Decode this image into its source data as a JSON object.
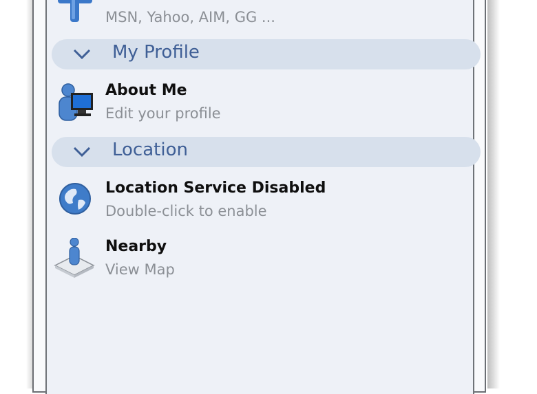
{
  "accounts": {
    "subtitle": "MSN, Yahoo, AIM, GG ...",
    "icon": "add-plus-icon"
  },
  "sections": {
    "my_profile": {
      "label": "My Profile"
    },
    "location": {
      "label": "Location"
    }
  },
  "about_me": {
    "title": "About Me",
    "subtitle": "Edit your profile",
    "icon": "user-computer-icon"
  },
  "location_service": {
    "title": "Location Service Disabled",
    "subtitle": "Double-click to enable",
    "icon": "globe-icon"
  },
  "nearby": {
    "title": "Nearby",
    "subtitle": "View Map",
    "icon": "map-pin-person-icon"
  },
  "colors": {
    "section_header_bg": "#d7e0ec",
    "section_header_text": "#3f5f96",
    "panel_bg": "#eef1f7",
    "icon_blue": "#3b78c9"
  }
}
